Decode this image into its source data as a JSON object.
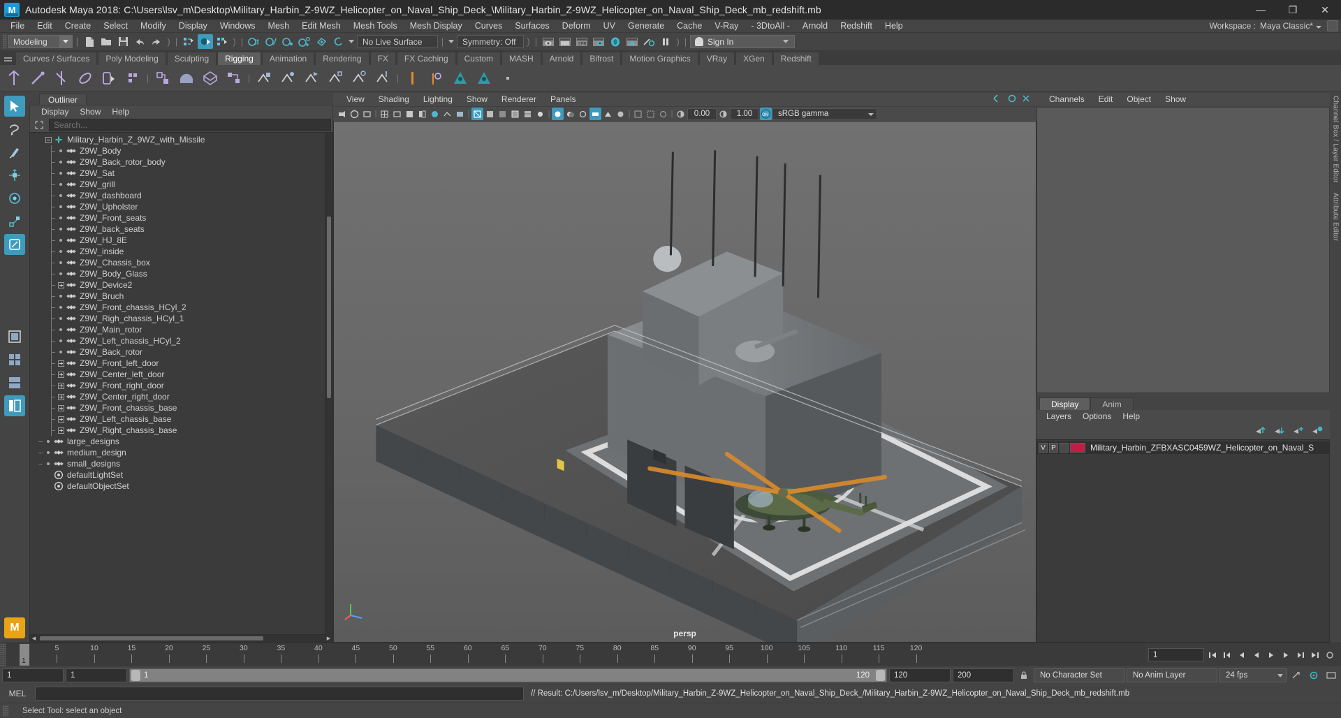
{
  "titlebar": {
    "app_title": "Autodesk Maya 2018: C:\\Users\\lsv_m\\Desktop\\Military_Harbin_Z-9WZ_Helicopter_on_Naval_Ship_Deck_\\Military_Harbin_Z-9WZ_Helicopter_on_Naval_Ship_Deck_mb_redshift.mb",
    "logo": "M",
    "minimize": "—",
    "maximize": "❐",
    "close": "✕"
  },
  "menubar": {
    "items": [
      "File",
      "Edit",
      "Create",
      "Select",
      "Modify",
      "Display",
      "Windows",
      "Mesh",
      "Edit Mesh",
      "Mesh Tools",
      "Mesh Display",
      "Curves",
      "Surfaces",
      "Deform",
      "UV",
      "Generate",
      "Cache",
      "V-Ray",
      "- 3DtoAll -",
      "Arnold",
      "Redshift",
      "Help"
    ],
    "workspace_label": "Workspace :",
    "workspace_value": "Maya Classic*"
  },
  "statusbar": {
    "mode": "Modeling",
    "live_surface": "No Live Surface",
    "symmetry": "Symmetry: Off",
    "signin": "Sign In"
  },
  "shelf": {
    "tabs": [
      "Curves / Surfaces",
      "Poly Modeling",
      "Sculpting",
      "Rigging",
      "Animation",
      "Rendering",
      "FX",
      "FX Caching",
      "Custom",
      "MASH",
      "Arnold",
      "Bifrost",
      "Motion Graphics",
      "VRay",
      "XGen",
      "Redshift"
    ],
    "active_tab": "Rigging"
  },
  "outliner": {
    "panel_tab": "Outliner",
    "menu": [
      "Display",
      "Show",
      "Help"
    ],
    "search_placeholder": "Search...",
    "items": [
      {
        "label": "Military_Harbin_Z_9WZ_with_Missile",
        "depth": 0,
        "expander": "minus",
        "icon": "star-icon"
      },
      {
        "label": "Z9W_Body",
        "depth": 1,
        "expander": "dot",
        "icon": "mesh-icon"
      },
      {
        "label": "Z9W_Back_rotor_body",
        "depth": 1,
        "expander": "dot",
        "icon": "mesh-icon"
      },
      {
        "label": "Z9W_Sat",
        "depth": 1,
        "expander": "dot",
        "icon": "mesh-icon"
      },
      {
        "label": "Z9W_grill",
        "depth": 1,
        "expander": "dot",
        "icon": "mesh-icon"
      },
      {
        "label": "Z9W_dashboard",
        "depth": 1,
        "expander": "dot",
        "icon": "mesh-icon"
      },
      {
        "label": "Z9W_Upholster",
        "depth": 1,
        "expander": "dot",
        "icon": "mesh-icon"
      },
      {
        "label": "Z9W_Front_seats",
        "depth": 1,
        "expander": "dot",
        "icon": "mesh-icon"
      },
      {
        "label": "Z9W_back_seats",
        "depth": 1,
        "expander": "dot",
        "icon": "mesh-icon"
      },
      {
        "label": "Z9W_HJ_8E",
        "depth": 1,
        "expander": "dot",
        "icon": "mesh-icon"
      },
      {
        "label": "Z9W_inside",
        "depth": 1,
        "expander": "dot",
        "icon": "mesh-icon"
      },
      {
        "label": "Z9W_Chassis_box",
        "depth": 1,
        "expander": "dot",
        "icon": "mesh-icon"
      },
      {
        "label": "Z9W_Body_Glass",
        "depth": 1,
        "expander": "dot",
        "icon": "mesh-icon"
      },
      {
        "label": "Z9W_Device2",
        "depth": 1,
        "expander": "plus",
        "icon": "mesh-icon"
      },
      {
        "label": "Z9W_Bruch",
        "depth": 1,
        "expander": "dot",
        "icon": "mesh-icon"
      },
      {
        "label": "Z9W_Front_chassis_HCyl_2",
        "depth": 1,
        "expander": "dot",
        "icon": "mesh-icon"
      },
      {
        "label": "Z9W_Righ_chassis_HCyl_1",
        "depth": 1,
        "expander": "dot",
        "icon": "mesh-icon"
      },
      {
        "label": "Z9W_Main_rotor",
        "depth": 1,
        "expander": "dot",
        "icon": "mesh-icon"
      },
      {
        "label": "Z9W_Left_chassis_HCyl_2",
        "depth": 1,
        "expander": "dot",
        "icon": "mesh-icon"
      },
      {
        "label": "Z9W_Back_rotor",
        "depth": 1,
        "expander": "dot",
        "icon": "mesh-icon"
      },
      {
        "label": "Z9W_Front_left_door",
        "depth": 1,
        "expander": "plus",
        "icon": "mesh-icon"
      },
      {
        "label": "Z9W_Center_left_door",
        "depth": 1,
        "expander": "plus",
        "icon": "mesh-icon"
      },
      {
        "label": "Z9W_Front_right_door",
        "depth": 1,
        "expander": "plus",
        "icon": "mesh-icon"
      },
      {
        "label": "Z9W_Center_right_door",
        "depth": 1,
        "expander": "plus",
        "icon": "mesh-icon"
      },
      {
        "label": "Z9W_Front_chassis_base",
        "depth": 1,
        "expander": "plus",
        "icon": "mesh-icon"
      },
      {
        "label": "Z9W_Left_chassis_base",
        "depth": 1,
        "expander": "plus",
        "icon": "mesh-icon"
      },
      {
        "label": "Z9W_Right_chassis_base",
        "depth": 1,
        "expander": "plus",
        "icon": "mesh-icon"
      },
      {
        "label": "large_designs",
        "depth": 0,
        "expander": "dot",
        "icon": "mesh-icon"
      },
      {
        "label": "medium_design",
        "depth": 0,
        "expander": "dot",
        "icon": "mesh-icon"
      },
      {
        "label": "small_designs",
        "depth": 0,
        "expander": "dot",
        "icon": "mesh-icon"
      },
      {
        "label": "defaultLightSet",
        "depth": 0,
        "expander": "none",
        "icon": "set-icon"
      },
      {
        "label": "defaultObjectSet",
        "depth": 0,
        "expander": "none",
        "icon": "set-icon"
      }
    ]
  },
  "viewport": {
    "menu": [
      "View",
      "Shading",
      "Lighting",
      "Show",
      "Renderer",
      "Panels"
    ],
    "exposure": "0.00",
    "gamma": "1.00",
    "color_profile": "sRGB gamma",
    "camera_label": "persp",
    "axis": {
      "x": "x",
      "y": "y",
      "z": "z"
    }
  },
  "channelbox": {
    "menu": [
      "Channels",
      "Edit",
      "Object",
      "Show"
    ]
  },
  "layers": {
    "tabs": [
      "Display",
      "Anim"
    ],
    "active_tab": "Display",
    "menu": [
      "Layers",
      "Options",
      "Help"
    ],
    "rows": [
      {
        "visibility": "V",
        "playback": "P",
        "color": "#c41c44",
        "name": "Military_Harbin_ZFBXASC0459WZ_Helicopter_on_Naval_S"
      }
    ]
  },
  "edge_tabs": [
    "Channel Box / Layer Editor",
    "Attribute Editor"
  ],
  "timeline": {
    "current_frame": "1",
    "ticks": [
      5,
      10,
      15,
      20,
      25,
      30,
      35,
      40,
      45,
      50,
      55,
      60,
      65,
      70,
      75,
      80,
      85,
      90,
      95,
      100,
      105,
      110,
      115,
      120
    ],
    "end_field": "1"
  },
  "rangebar": {
    "start": "1",
    "anim_start": "1",
    "range_min": "1",
    "range_max": "120",
    "playback_end": "120",
    "anim_end": "200",
    "character_set": "No Character Set",
    "anim_layer": "No Anim Layer",
    "fps": "24 fps"
  },
  "mel": {
    "label": "MEL",
    "input_value": "",
    "output": "// Result: C:/Users/lsv_m/Desktop/Military_Harbin_Z-9WZ_Helicopter_on_Naval_Ship_Deck_/Military_Harbin_Z-9WZ_Helicopter_on_Naval_Ship_Deck_mb_redshift.mb"
  },
  "helpline": {
    "text": "Select Tool: select an object"
  },
  "colors": {
    "accent": "#3e9bbd",
    "panel_bg": "#444444",
    "list_bg": "#3b3b3b",
    "layer_swatch": "#c41c44",
    "viewport_bg": "#6b6b6b"
  }
}
